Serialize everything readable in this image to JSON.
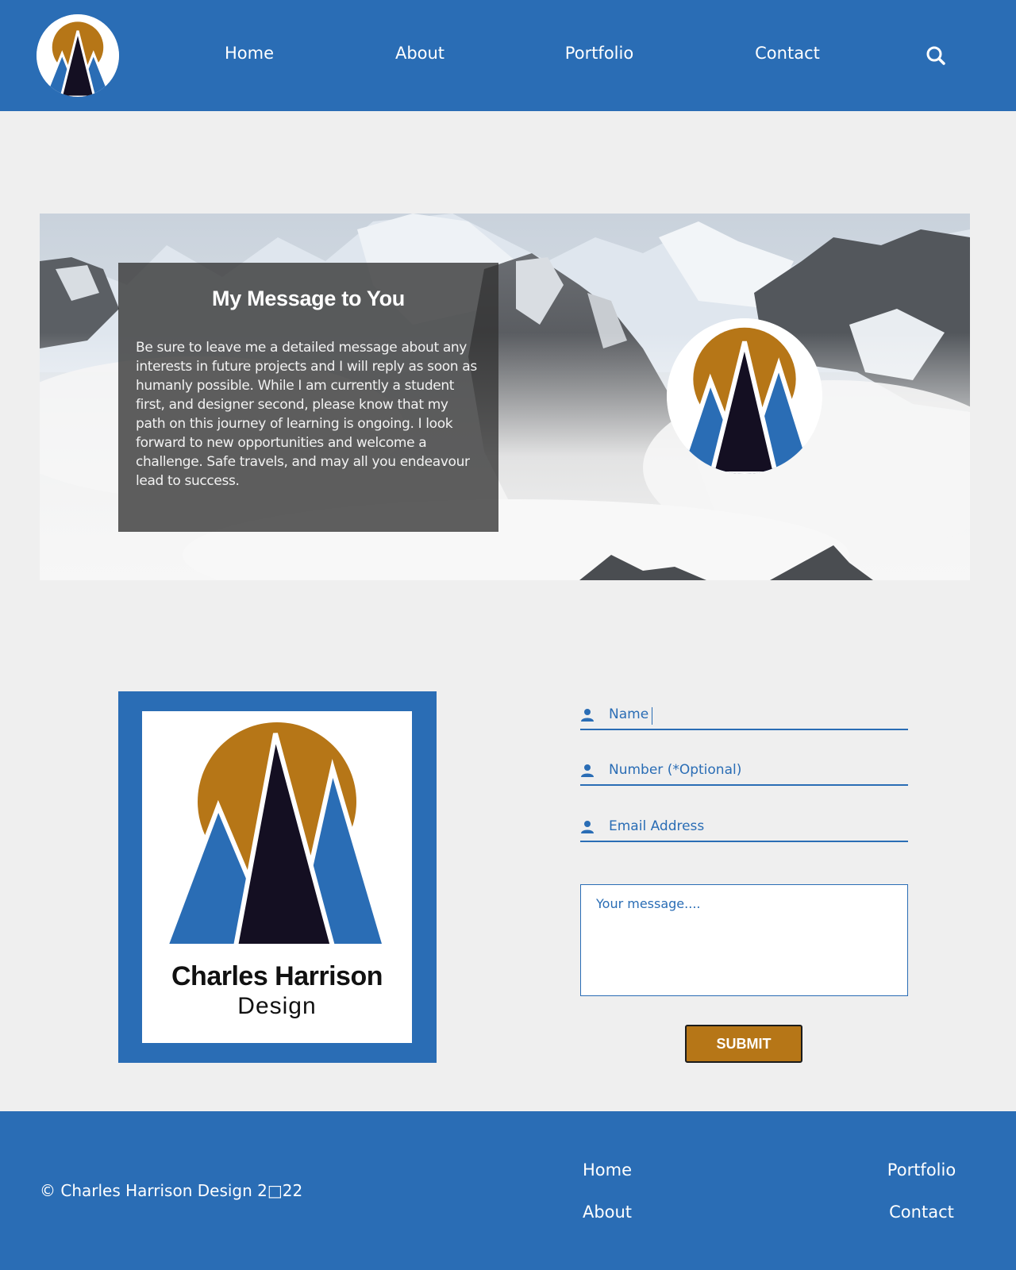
{
  "header": {
    "logo_icon": "mountain-sun-logo",
    "nav": {
      "home": "Home",
      "about": "About",
      "portfolio": "Portfolio",
      "contact": "Contact"
    },
    "search_icon": "search-icon"
  },
  "hero": {
    "title": "My Message to You",
    "body": "Be sure to leave me a detailed message about any interests in future projects and I will reply as soon as humanly possible. While I am currently a student first, and designer second, please know that my path on this journey of learning is ongoing. I look forward to new opportunities and welcome a challenge. Safe travels, and may all you endeavour lead to success."
  },
  "brand": {
    "name": "Charles Harrison",
    "subtitle": "Design"
  },
  "form": {
    "name_placeholder": "Name",
    "number_placeholder": "Number (*Optional)",
    "email_placeholder": "Email Address",
    "message_placeholder": "Your message....",
    "submit_label": "SUBMIT",
    "field_icon": "user-icon"
  },
  "footer": {
    "copyright": "© Charles Harrison Design 2□22",
    "links": {
      "home": "Home",
      "about": "About",
      "portfolio": "Portfolio",
      "contact": "Contact"
    }
  },
  "colors": {
    "brand_blue": "#2a6db5",
    "accent_gold": "#b67617",
    "logo_dark": "#140f22",
    "page_background": "#efefef"
  }
}
